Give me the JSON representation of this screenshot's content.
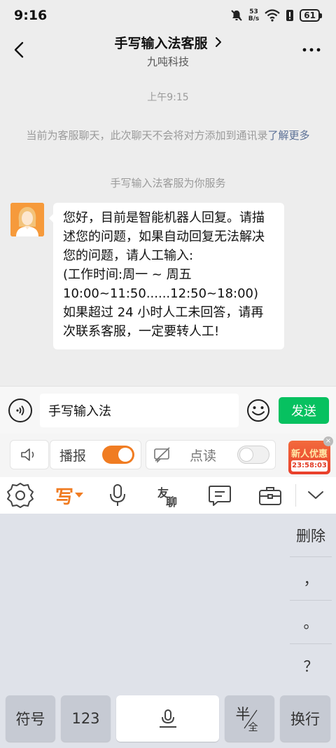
{
  "status_bar": {
    "time": "9:16",
    "net_speed_value": "53",
    "net_speed_unit": "B/s",
    "battery": "61",
    "icons": [
      "mute-bell-icon",
      "wifi-icon",
      "battery-alert-icon",
      "battery-icon"
    ]
  },
  "header": {
    "title": "手写输入法客服",
    "subtitle": "九吨科技"
  },
  "chat": {
    "timestamp": "上午9:15",
    "notice_text": "当前为客服聊天，此次聊天不会将对方添加到通讯录",
    "notice_link": "了解更多",
    "service_text": "手写输入法客服为你服务",
    "messages": [
      {
        "sender": "agent",
        "text": "您好，目前是智能机器人回复。请描述您的问题，如果自动回复无法解决您的问题，请人工输入:\n(工作时间:周一 ~ 周五 10:00~11:50......12:50~18:00)\n如果超过 24 小时人工未回答，请再次联系客服，一定要转人工!"
      }
    ]
  },
  "input_bar": {
    "value": "手写输入法",
    "send_label": "发送"
  },
  "keyboard_top": {
    "broadcast_label": "播报",
    "broadcast_on": true,
    "read_label": "点读",
    "read_on": false,
    "promo_title": "新人优惠",
    "promo_timer": "23:58:03",
    "promo_close": "×"
  },
  "keyboard_toolbar": {
    "write_label": "写",
    "items": [
      "settings-icon",
      "handwrite-mode",
      "mic-icon",
      "friend-chat-icon",
      "quick-phrase-icon",
      "toolbox-icon",
      "collapse-icon"
    ]
  },
  "keyboard": {
    "side_keys": [
      "删除",
      "，",
      "。",
      "？"
    ],
    "symbol_label": "符号",
    "num_label": "123",
    "half_label": "半",
    "half_sub": "全",
    "enter_label": "换行"
  },
  "colors": {
    "accent_orange": "#f07c22",
    "send_green": "#07c160",
    "link_blue": "#5a6f95"
  }
}
